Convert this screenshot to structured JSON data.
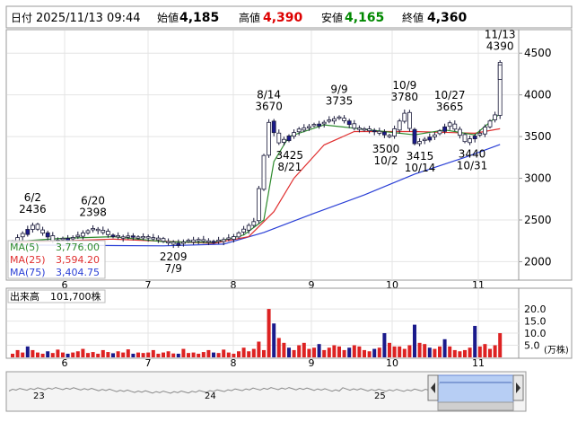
{
  "header": {
    "date_label": "日付",
    "date": "2025/11/13 09:44",
    "open_label": "始値",
    "open": "4,185",
    "high_label": "高値",
    "high": "4,390",
    "low_label": "安値",
    "low": "4,165",
    "close_label": "終値",
    "close": "4,360"
  },
  "legend": {
    "ma5": "MA(5)",
    "ma5_value": "3,776.00",
    "ma25": "MA(25)",
    "ma25_value": "3,594.20",
    "ma75": "MA(75)",
    "ma75_value": "3,404.75"
  },
  "volume_label": "出来高",
  "volume_value": "101,700株",
  "volume_unit": "(万株)",
  "navigator_labels": [
    "23",
    "24",
    "25"
  ],
  "colors": {
    "up": "#ffffff",
    "down": "#1a1a8c",
    "ma5": "#2e8b2e",
    "ma25": "#e03030",
    "ma75": "#2a3fd6",
    "vol_up": "#dd2222",
    "vol_down": "#1a1a8c",
    "header_high": "#dd0000",
    "header_low": "#008800"
  },
  "chart_data": [
    {
      "type": "candlestick",
      "x_labels": [
        "6",
        "7",
        "8",
        "9",
        "10",
        "11"
      ],
      "y_ticks": [
        2000,
        2500,
        3000,
        3500,
        4000,
        4500
      ],
      "ylim": [
        1800,
        4750
      ],
      "points": [
        {
          "x": 0,
          "v": 2240
        },
        {
          "x": 4,
          "v": 2436
        },
        {
          "x": 8,
          "v": 2250
        },
        {
          "x": 12,
          "v": 2290
        },
        {
          "x": 16,
          "v": 2398
        },
        {
          "x": 20,
          "v": 2300
        },
        {
          "x": 24,
          "v": 2295
        },
        {
          "x": 28,
          "v": 2280
        },
        {
          "x": 32,
          "v": 2209
        },
        {
          "x": 36,
          "v": 2260
        },
        {
          "x": 40,
          "v": 2230
        },
        {
          "x": 44,
          "v": 2300
        },
        {
          "x": 48,
          "v": 2480
        },
        {
          "x": 51,
          "v": 3670
        },
        {
          "x": 53,
          "v": 3425
        },
        {
          "x": 57,
          "v": 3590
        },
        {
          "x": 61,
          "v": 3650
        },
        {
          "x": 65,
          "v": 3735
        },
        {
          "x": 68,
          "v": 3600
        },
        {
          "x": 72,
          "v": 3560
        },
        {
          "x": 75,
          "v": 3500
        },
        {
          "x": 78,
          "v": 3780
        },
        {
          "x": 80,
          "v": 3415
        },
        {
          "x": 84,
          "v": 3520
        },
        {
          "x": 87,
          "v": 3665
        },
        {
          "x": 90,
          "v": 3440
        },
        {
          "x": 93,
          "v": 3540
        },
        {
          "x": 96,
          "v": 3760
        },
        {
          "x": 97,
          "v": 4390
        }
      ],
      "annotations": [
        {
          "date": "6/2",
          "value": "2436",
          "pos": "above"
        },
        {
          "date": "6/20",
          "value": "2398",
          "pos": "above"
        },
        {
          "date": "7/9",
          "value": "2209",
          "pos": "below"
        },
        {
          "date": "8/14",
          "value": "3670",
          "pos": "above"
        },
        {
          "date": "8/21",
          "value": "3425",
          "pos": "below"
        },
        {
          "date": "9/9",
          "value": "3735",
          "pos": "above"
        },
        {
          "date": "10/2",
          "value": "3500",
          "pos": "below"
        },
        {
          "date": "10/9",
          "value": "3780",
          "pos": "above"
        },
        {
          "date": "10/14",
          "value": "3415",
          "pos": "below"
        },
        {
          "date": "10/27",
          "value": "3665",
          "pos": "above"
        },
        {
          "date": "10/31",
          "value": "3440",
          "pos": "below"
        },
        {
          "date": "11/13",
          "value": "4390",
          "pos": "above"
        }
      ],
      "ma5": [
        [
          0,
          2240
        ],
        [
          10,
          2280
        ],
        [
          20,
          2300
        ],
        [
          30,
          2240
        ],
        [
          40,
          2230
        ],
        [
          46,
          2320
        ],
        [
          50,
          2500
        ],
        [
          52,
          3200
        ],
        [
          55,
          3500
        ],
        [
          62,
          3640
        ],
        [
          68,
          3600
        ],
        [
          74,
          3560
        ],
        [
          80,
          3520
        ],
        [
          86,
          3580
        ],
        [
          92,
          3520
        ],
        [
          97,
          3776
        ]
      ],
      "ma25": [
        [
          0,
          2230
        ],
        [
          20,
          2270
        ],
        [
          40,
          2220
        ],
        [
          47,
          2300
        ],
        [
          52,
          2600
        ],
        [
          56,
          3000
        ],
        [
          62,
          3400
        ],
        [
          68,
          3560
        ],
        [
          80,
          3560
        ],
        [
          92,
          3540
        ],
        [
          97,
          3594
        ]
      ],
      "ma75": [
        [
          0,
          2200
        ],
        [
          30,
          2190
        ],
        [
          42,
          2210
        ],
        [
          50,
          2350
        ],
        [
          60,
          2580
        ],
        [
          70,
          2800
        ],
        [
          80,
          3050
        ],
        [
          90,
          3250
        ],
        [
          97,
          3405
        ]
      ]
    },
    {
      "type": "bar",
      "title": "出来高",
      "y_ticks": [
        5.0,
        10.0,
        15.0,
        20.0
      ],
      "ylim": [
        0,
        23
      ],
      "values": [
        1.5,
        3.0,
        2.0,
        4.5,
        3.0,
        2.0,
        1.5,
        2.5,
        1.8,
        3.2,
        2.0,
        1.5,
        2.0,
        2.5,
        3.5,
        1.8,
        2.2,
        1.5,
        3.0,
        2.2,
        1.7,
        2.5,
        2.0,
        3.3,
        1.5,
        2.0,
        1.8,
        2.0,
        3.0,
        1.5,
        2.0,
        2.5,
        1.6,
        1.5,
        3.5,
        1.8,
        2.0,
        1.5,
        2.2,
        3.0,
        2.0,
        1.8,
        3.2,
        2.0,
        1.5,
        2.5,
        4.0,
        2.5,
        3.5,
        6.5,
        3.0,
        20.0,
        14.0,
        8.0,
        6.0,
        4.0,
        3.0,
        5.0,
        6.0,
        3.5,
        4.0,
        5.5,
        3.0,
        4.0,
        5.0,
        4.5,
        3.0,
        4.0,
        5.0,
        4.5,
        3.0,
        2.5,
        3.5,
        4.0,
        10.0,
        6.0,
        4.5,
        4.5,
        3.5,
        5.0,
        13.5,
        6.0,
        5.5,
        4.0,
        3.5,
        4.5,
        7.5,
        4.5,
        3.0,
        2.5,
        3.0,
        4.0,
        13.0,
        4.5,
        5.5,
        3.5,
        5.0,
        10.0
      ],
      "down": [
        3,
        7,
        11,
        20,
        24,
        33,
        40,
        52,
        55,
        61,
        67,
        72,
        74,
        80,
        83,
        86,
        92
      ]
    }
  ]
}
